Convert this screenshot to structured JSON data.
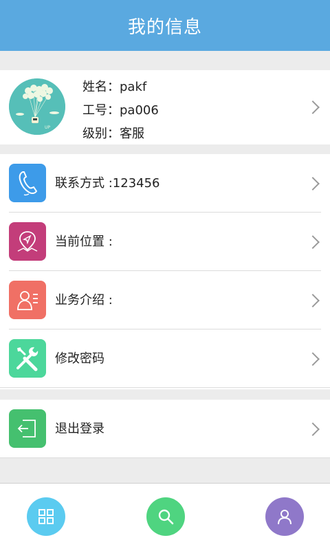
{
  "header": {
    "title": "我的信息"
  },
  "profile": {
    "name_label": "姓名：",
    "name": "pakf",
    "id_label": "工号：",
    "id": "pa006",
    "level_label": "级别：",
    "level": "客服",
    "avatar_icon": "balloon-avatar-icon"
  },
  "menu": {
    "contact": {
      "label": "联系方式 :123456",
      "icon": "phone-icon",
      "color": "#3d9be9"
    },
    "location": {
      "label": "当前位置 :",
      "icon": "map-pin-icon",
      "color": "#c33d7a"
    },
    "business": {
      "label": "业务介绍 :",
      "icon": "profile-card-icon",
      "color": "#f07065"
    },
    "password": {
      "label": "修改密码",
      "icon": "tools-icon",
      "color": "#4cd79b"
    },
    "logout": {
      "label": "退出登录",
      "icon": "exit-icon",
      "color": "#45c06f"
    }
  },
  "bottom_nav": {
    "home": {
      "icon": "grid-icon",
      "color": "#5bcbf0"
    },
    "search": {
      "icon": "search-icon",
      "color": "#4fd480"
    },
    "user": {
      "icon": "user-icon",
      "color": "#8f78c9"
    }
  }
}
